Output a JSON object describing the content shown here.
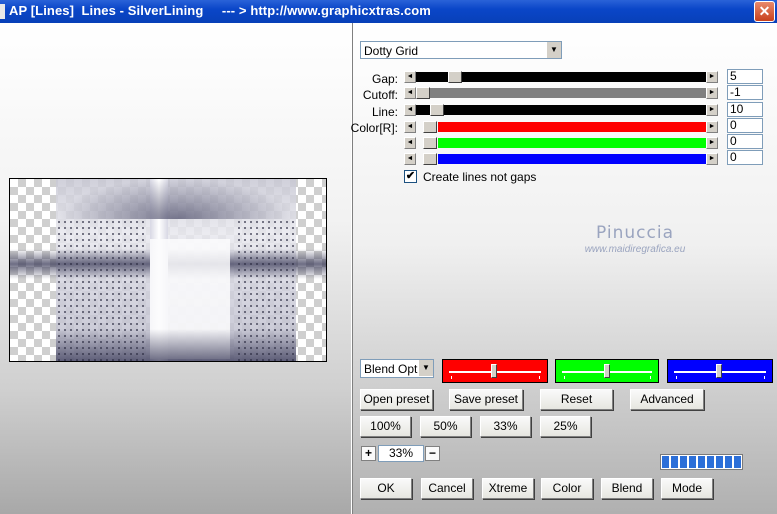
{
  "window": {
    "title": "AP [Lines]  Lines - SilverLining     --- > http://www.graphicxtras.com",
    "close_glyph": "✕"
  },
  "effect": {
    "selected": "Dotty Grid"
  },
  "params": [
    {
      "label": "Gap:",
      "value": "5"
    },
    {
      "label": "Cutoff:",
      "value": "-1"
    },
    {
      "label": "Line:",
      "value": "10"
    },
    {
      "label": "Color[R]:",
      "value": "0"
    },
    {
      "label": "",
      "value": "0"
    },
    {
      "label": "",
      "value": "0"
    }
  ],
  "checkbox": {
    "label": "Create lines not gaps",
    "checked": true,
    "glyph": "✔"
  },
  "watermark": {
    "name": "Pinuccia",
    "url": "www.maidiregrafica.eu"
  },
  "blend": {
    "selected": "Blend Optio"
  },
  "color_sliders": {
    "red": "#ff0000",
    "green": "#00ff00",
    "blue": "#0000ff"
  },
  "buttons": {
    "open_preset": "Open preset",
    "save_preset": "Save preset",
    "reset": "Reset",
    "advanced": "Advanced",
    "zoom100": "100%",
    "zoom50": "50%",
    "zoom33": "33%",
    "zoom25": "25%",
    "ok": "OK",
    "cancel": "Cancel",
    "xtreme": "Xtreme",
    "color": "Color",
    "blend": "Blend",
    "mode": "Mode"
  },
  "zoom": {
    "plus": "+",
    "minus": "−",
    "value": "33%"
  },
  "progress": {
    "filled_segments": 9
  },
  "icons": {
    "dropdown": "chevron-down-icon",
    "arrow_left": "arrow-left-icon",
    "arrow_right": "arrow-right-icon",
    "close": "close-icon",
    "check": "checkmark-icon"
  },
  "colors": {
    "titlebar": "#0a46c8",
    "progress": "#2c6fd8"
  }
}
